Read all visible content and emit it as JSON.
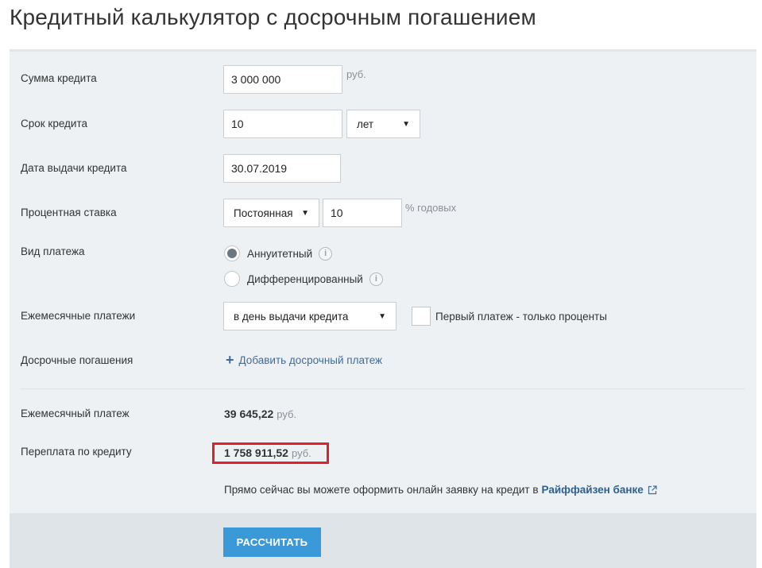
{
  "page": {
    "title": "Кредитный калькулятор с досрочным погашением"
  },
  "form": {
    "amount": {
      "label": "Сумма кредита",
      "value": "3 000 000",
      "unit": "руб."
    },
    "term": {
      "label": "Срок кредита",
      "value": "10",
      "unit_selected": "лет"
    },
    "issue_date": {
      "label": "Дата выдачи кредита",
      "value": "30.07.2019"
    },
    "rate": {
      "label": "Процентная ставка",
      "type_selected": "Постоянная",
      "value": "10",
      "unit": "% годовых"
    },
    "payment_type": {
      "label": "Вид платежа",
      "options": [
        {
          "label": "Аннуитетный",
          "selected": true
        },
        {
          "label": "Дифференцированный",
          "selected": false
        }
      ]
    },
    "monthly_payments": {
      "label": "Ежемесячные платежи",
      "selected": "в день выдачи кредита",
      "checkbox_label": "Первый платеж - только проценты",
      "checkbox_checked": false
    },
    "early_repayments": {
      "label": "Досрочные погашения",
      "add_link": "Добавить досрочный платеж"
    }
  },
  "results": {
    "monthly_payment": {
      "label": "Ежемесячный платеж",
      "value": "39 645,22",
      "unit": "руб."
    },
    "overpayment": {
      "label": "Переплата по кредиту",
      "value": "1 758 911,52",
      "unit": "руб."
    }
  },
  "promo": {
    "text": "Прямо сейчас вы можете оформить онлайн заявку на кредит в",
    "bank": "Райффайзен банке"
  },
  "actions": {
    "calculate": "РАССЧИТАТЬ"
  },
  "colors": {
    "accent": "#3a9ad9",
    "highlight": "#e0202a",
    "link": "#3d6d9a",
    "panel_bg": "#eef1f3"
  }
}
